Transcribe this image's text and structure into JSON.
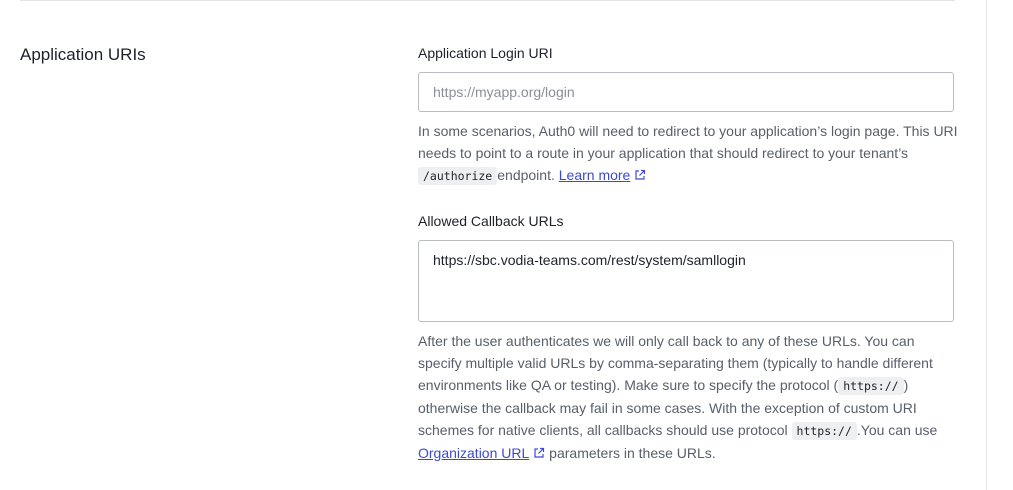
{
  "section": {
    "title": "Application URIs"
  },
  "login_uri": {
    "label": "Application Login URI",
    "placeholder": "https://myapp.org/login",
    "value": "",
    "help_before_code": "In some scenarios, Auth0 will need to redirect to your application’s login page. This URI needs to point to a route in your application that should redirect to your tenant’s ",
    "help_code": "/authorize",
    "help_after_code": "endpoint. ",
    "help_link": "Learn more"
  },
  "callback_urls": {
    "label": "Allowed Callback URLs",
    "value": "https://sbc.vodia-teams.com/rest/system/samllogin",
    "help_part1": "After the user authenticates we will only call back to any of these URLs. You can specify multiple valid URLs by comma-separating them (typically to handle different environments like QA or testing). Make sure to specify the protocol (",
    "help_code1": "https://",
    "help_part2": ") otherwise the callback may fail in some cases. With the exception of custom URI schemes for native clients, all callbacks should use protocol ",
    "help_code2": "https://",
    "help_part3": ".You can use ",
    "help_link": "Organization URL",
    "help_part4": " parameters in these URLs."
  },
  "icons": {
    "external_link": "external-link-icon"
  },
  "colors": {
    "link": "#3b4ad6",
    "help_text": "#585f6a",
    "border": "#b9bcc1"
  }
}
